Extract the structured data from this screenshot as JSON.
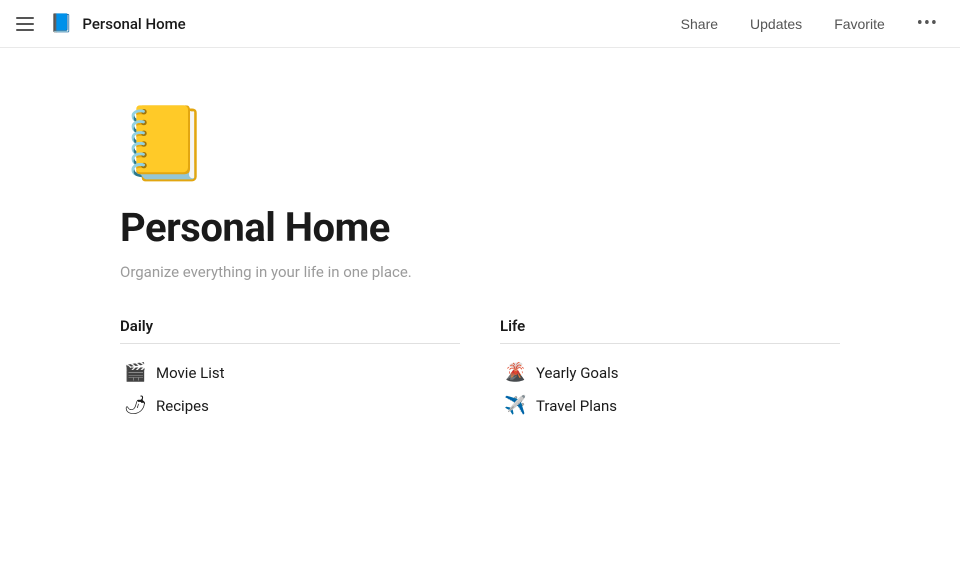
{
  "topbar": {
    "menu_icon": "☰",
    "page_icon": "📘",
    "title": "Personal Home",
    "actions": {
      "share": "Share",
      "updates": "Updates",
      "favorite": "Favorite",
      "more": "•••"
    }
  },
  "page": {
    "emoji": "📒",
    "heading": "Personal Home",
    "subtitle": "Organize everything in your life in one place."
  },
  "sections": [
    {
      "id": "daily",
      "heading": "Daily",
      "items": [
        {
          "emoji": "🎬",
          "label": "Movie List"
        },
        {
          "emoji": "🌶",
          "label": "Recipes"
        }
      ]
    },
    {
      "id": "life",
      "heading": "Life",
      "items": [
        {
          "emoji": "🌋",
          "label": "Yearly Goals"
        },
        {
          "emoji": "✈️",
          "label": "Travel Plans"
        }
      ]
    }
  ]
}
